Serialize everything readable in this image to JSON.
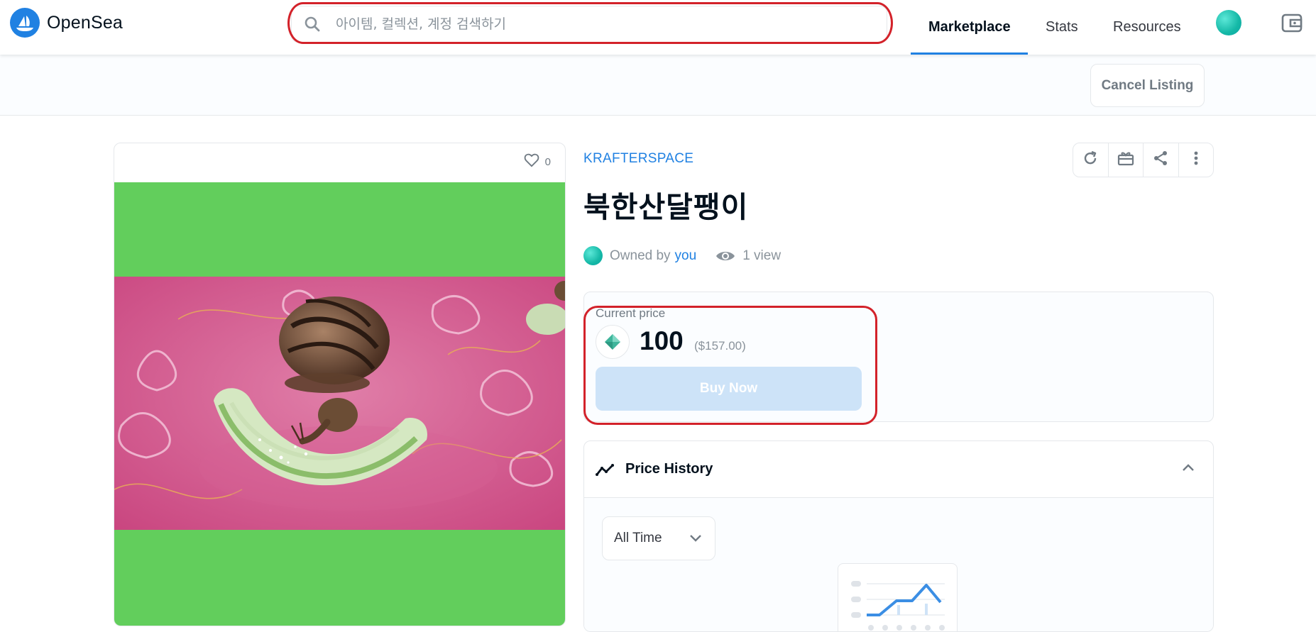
{
  "brand": {
    "name": "OpenSea",
    "accent": "#2081e2"
  },
  "search": {
    "placeholder": "아이템, 컬렉션, 계정 검색하기",
    "value": ""
  },
  "nav": {
    "items": [
      {
        "label": "Marketplace",
        "active": true
      },
      {
        "label": "Stats",
        "active": false
      },
      {
        "label": "Resources",
        "active": false
      }
    ],
    "icons": [
      "profile-avatar",
      "wallet-icon"
    ]
  },
  "listing_bar": {
    "cancel_label": "Cancel Listing"
  },
  "media": {
    "favorites_count": "0",
    "background_color": "#62ce5c"
  },
  "item": {
    "collection": "KRAFTERSPACE",
    "title": "북한산달팽이",
    "owned_by_label": "Owned by",
    "owner": "you",
    "views": "1 view"
  },
  "toolbar": {
    "icons": [
      "refresh-icon",
      "gift-icon",
      "share-icon",
      "more-icon"
    ]
  },
  "price": {
    "label": "Current price",
    "amount": "100",
    "usd": "($157.00)",
    "buy_label": "Buy Now"
  },
  "price_history": {
    "title": "Price History",
    "range_selected": "All Time"
  },
  "annotation_color": "#d3222a"
}
